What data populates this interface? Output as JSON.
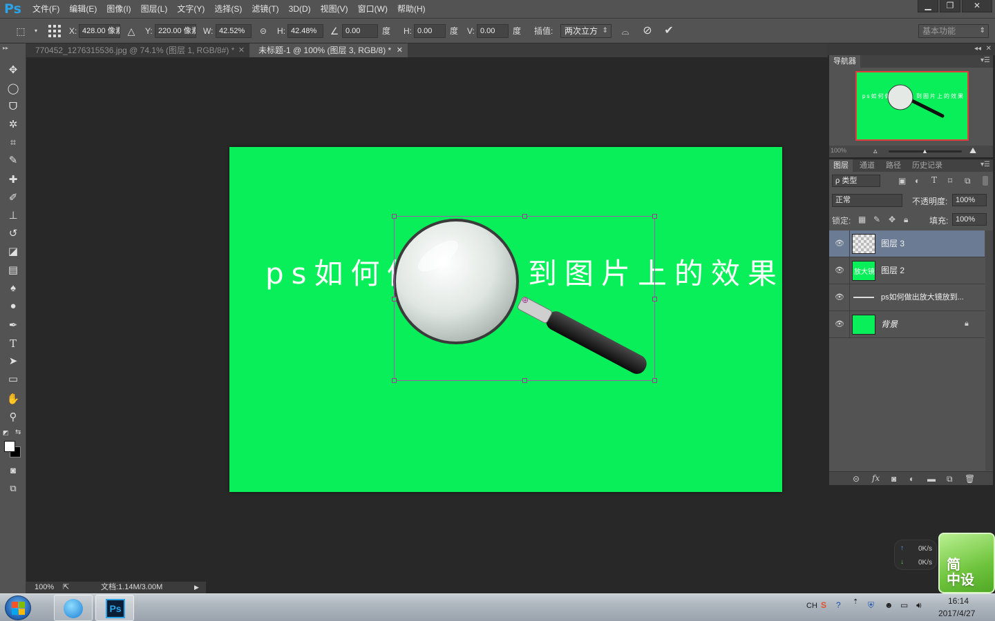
{
  "app": {
    "logo": "Ps"
  },
  "menu": [
    "文件(F)",
    "编辑(E)",
    "图像(I)",
    "图层(L)",
    "文字(Y)",
    "选择(S)",
    "滤镜(T)",
    "3D(D)",
    "视图(V)",
    "窗口(W)",
    "帮助(H)"
  ],
  "window_controls": {
    "minimize": "▁",
    "restore": "❐",
    "close": "✕"
  },
  "options": {
    "x_label": "X:",
    "x_value": "428.00 像素",
    "y_label": "Y:",
    "y_value": "220.00 像素",
    "w_label": "W:",
    "w_value": "42.52%",
    "h_label": "H:",
    "h_value": "42.48%",
    "angle_value": "0.00",
    "angle_unit": "度",
    "hskew_label": "H:",
    "hskew_value": "0.00",
    "hskew_unit": "度",
    "vskew_label": "V:",
    "vskew_value": "0.00",
    "vskew_unit": "度",
    "interp_label": "插值:",
    "interp_value": "两次立方",
    "workspace": "基本功能"
  },
  "tabs": [
    {
      "label": "770452_1276315536.jpg @ 74.1% (图层 1, RGB/8#) *",
      "close": "✕"
    },
    {
      "label": "未标题-1 @ 100% (图层 3, RGB/8) *",
      "close": "✕"
    }
  ],
  "canvas": {
    "color": "#08ef5a",
    "text_left": "ps如何做出",
    "text_right": "到图片上的效果"
  },
  "status": {
    "zoom": "100%",
    "doc": "文档:1.14M/3.00M"
  },
  "navigator": {
    "tab": "导航器",
    "zoom": "100%",
    "thumb_text_left": "ps如何做出",
    "thumb_text_right": "到图片上的效果"
  },
  "layers_panel": {
    "tabs": [
      "图层",
      "通道",
      "路径",
      "历史记录"
    ],
    "filter": "ρ 类型",
    "blend_mode": "正常",
    "opacity_label": "不透明度:",
    "opacity": "100%",
    "lock_label": "锁定:",
    "fill_label": "填充:",
    "fill": "100%",
    "layers": [
      {
        "name": "图层 3",
        "selected": true
      },
      {
        "name": "图层 2",
        "selected": false,
        "thumb_text": "放大镜"
      },
      {
        "name": "ps如何做出放大镜放到...",
        "selected": false
      },
      {
        "name": "背景",
        "selected": false,
        "locked": true
      }
    ]
  },
  "netspeed": {
    "up": "0K/s",
    "down": "0K/s"
  },
  "widget": {
    "line1": "简",
    "line2": "中设"
  },
  "taskbar": {
    "lang": "CH",
    "time": "16:14",
    "date": "2017/4/27"
  },
  "colors": {
    "accent": "#2aa4e6",
    "selection": "#6a7b93",
    "canvas_green": "#08ef5a",
    "transform_box": "#9b5da8"
  }
}
